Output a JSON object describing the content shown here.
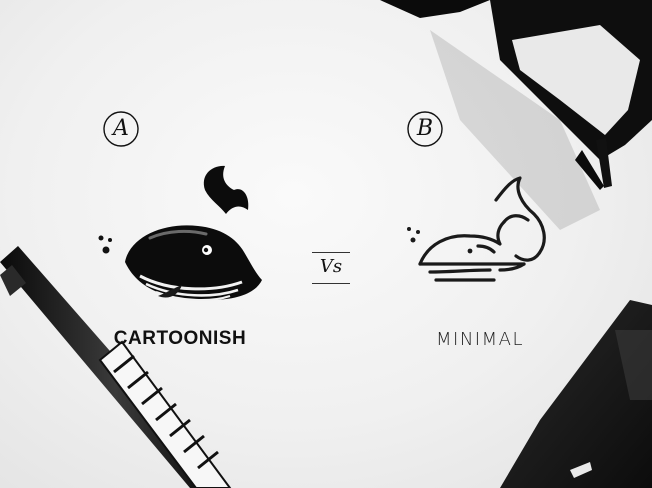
{
  "option_a": {
    "badge": "A",
    "label": "CARTOONISH",
    "icon": "cartoon-whale-icon"
  },
  "option_b": {
    "badge": "B",
    "label": "MINIMAL",
    "icon": "minimal-whale-icon"
  },
  "versus": "Vs",
  "colors": {
    "background": "#f1f1f1",
    "ink": "#111111"
  }
}
